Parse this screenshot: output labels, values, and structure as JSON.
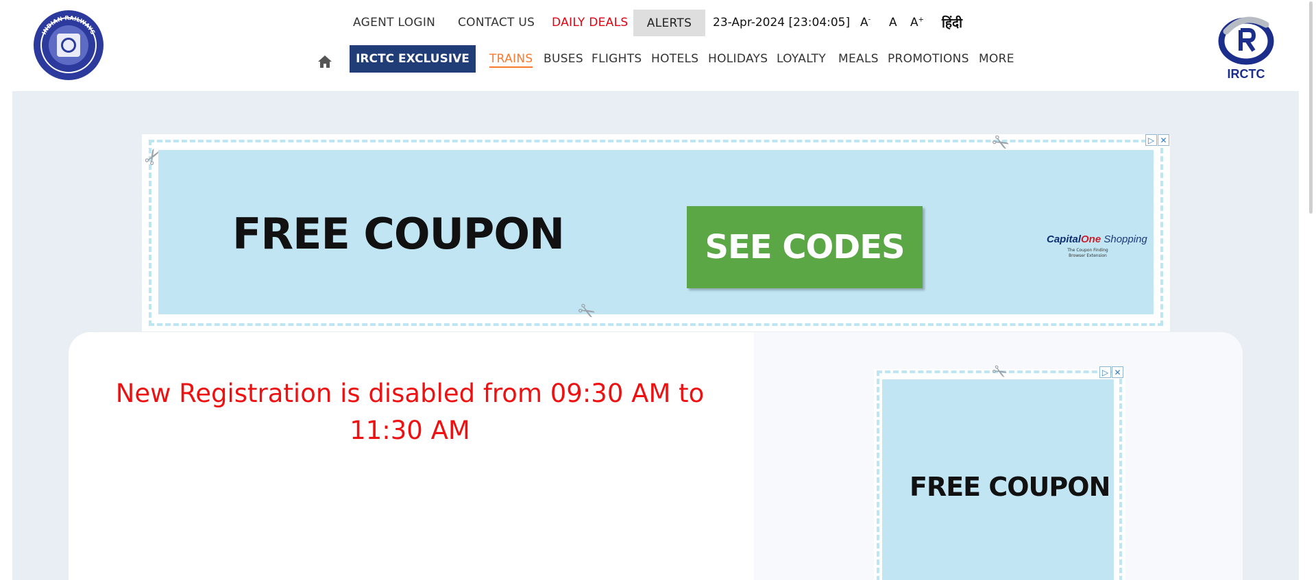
{
  "header": {
    "logo_left_text": "INDIAN RAILWAYS",
    "logo_right_text": "IRCTC",
    "top_links": {
      "agent_login": "AGENT LOGIN",
      "contact_us": "CONTACT US",
      "daily_deals": "DAILY DEALS",
      "alerts": "ALERTS",
      "datetime": "23-Apr-2024 [23:04:05]",
      "font_small": "A",
      "font_small_mark": "-",
      "font_normal": "A",
      "font_large": "A",
      "font_large_mark": "+",
      "hindi": "हिंदी"
    },
    "main_nav": {
      "exclusive": "IRCTC EXCLUSIVE",
      "items": [
        "TRAINS",
        "BUSES",
        "FLIGHTS",
        "HOTELS",
        "HOLIDAYS",
        "LOYALTY",
        "MEALS",
        "PROMOTIONS",
        "MORE"
      ],
      "active": "TRAINS"
    }
  },
  "banner_ad": {
    "headline": "FREE COUPON",
    "cta": "SEE CODES",
    "brand_cap": "Capital",
    "brand_one": "One",
    "brand_rest": " Shopping",
    "brand_sub": "The Coupon Finding Browser Extension"
  },
  "registration": {
    "message_line1": "New Registration is disabled from 09:30 AM to",
    "message_line2": "11:30 AM"
  },
  "side_ad": {
    "headline": "FREE COUPON"
  },
  "colors": {
    "nav_blue": "#213d77",
    "accent_orange": "#fb792b",
    "deals_red": "#e3000f",
    "message_red": "#ee1111",
    "ad_cta_green": "#5ba645",
    "ad_background": "#c1e5f3",
    "content_background": "#e9eef5"
  },
  "icons": {
    "home": "home-icon",
    "ad_choices": "ad-choices-icon",
    "ad_close": "close-icon",
    "scissors": "scissors-icon"
  }
}
